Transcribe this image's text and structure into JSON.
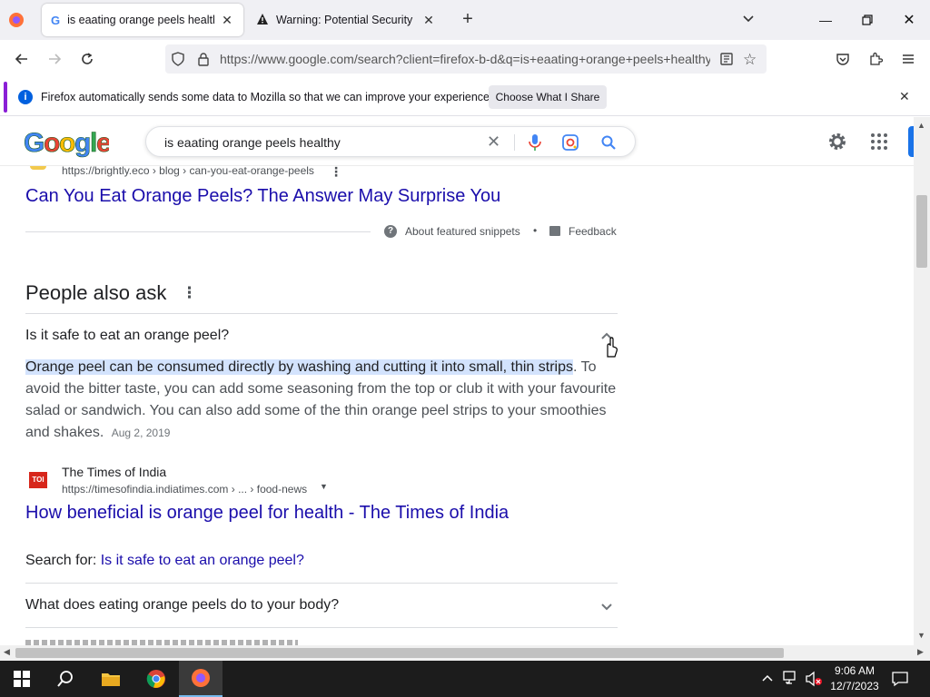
{
  "browser": {
    "tabs": [
      {
        "title": "is eaating orange peels healthy",
        "active": true,
        "icon": "google-g-icon"
      },
      {
        "title": "Warning: Potential Security Risk",
        "active": false,
        "icon": "warning-icon"
      }
    ],
    "url": "https://www.google.com/search?client=firefox-b-d&q=is+eaating+orange+peels+healthy"
  },
  "notification": {
    "message": "Firefox automatically sends some data to Mozilla so that we can improve your experience.",
    "button": "Choose What I Share"
  },
  "google": {
    "query": "is eaating orange peels healthy"
  },
  "results": {
    "top_result": {
      "breadcrumb": "https://brightly.eco › blog › can-you-eat-orange-peels",
      "title": "Can You Eat Orange Peels? The Answer May Surprise You"
    },
    "about_snippets": "About featured snippets",
    "feedback": "Feedback",
    "paa_heading": "People also ask",
    "expanded_question": "Is it safe to eat an orange peel?",
    "answer_highlight": "Orange peel can be consumed directly by washing and cutting it into small, thin strips",
    "answer_rest": ". To avoid the bitter taste, you can add some seasoning from the top or club it with your favourite salad or sandwich. You can also add some of the thin orange peel strips to your smoothies and shakes.",
    "answer_date": "Aug 2, 2019",
    "source": {
      "name": "The Times of India",
      "favicon_text": "TOI",
      "breadcrumb": "https://timesofindia.indiatimes.com › ... › food-news",
      "title": "How beneficial is orange peel for health - The Times of India"
    },
    "search_for_label": "Search for:",
    "search_for_link": "Is it safe to eat an orange peel?",
    "question2": "What does eating orange peels do to your body?"
  },
  "taskbar": {
    "time": "9:06 AM",
    "date": "12/7/2023"
  },
  "colors": {
    "link": "#1a0dab",
    "accent_purple": "#8a1fd6",
    "highlight": "#d3e3fd"
  }
}
